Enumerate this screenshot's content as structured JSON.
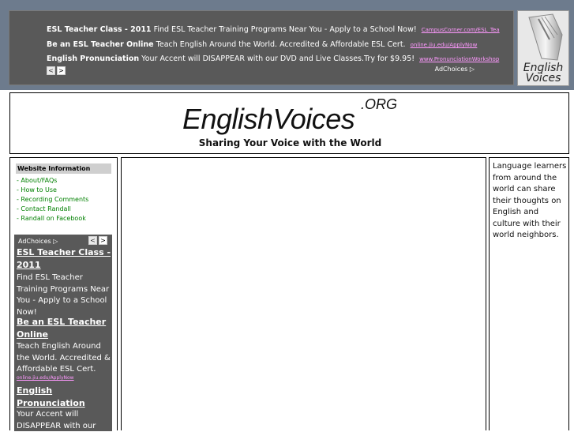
{
  "top_ad": {
    "lines": [
      {
        "title": "ESL Teacher Class - 2011",
        "body": "Find ESL Teacher Training Programs Near You - Apply to a School Now!",
        "url": "CampusCorner.com/ESL_Tea"
      },
      {
        "title": "Be an ESL Teacher Online",
        "body": "Teach English Around the World. Accredited & Affordable ESL Cert.",
        "url": "online.jiu.edu/ApplyNow"
      },
      {
        "title": "English Pronunciation",
        "body": "Your Accent will DISAPPEAR with our DVD and Live Classes.Try for $9.95!",
        "url": "www.PronunciationWorkshop"
      }
    ],
    "adchoices": "AdChoices ▷",
    "prev_icon": "<",
    "next_icon": ">"
  },
  "logo": {
    "text_line1": "English",
    "text_line2": "Voices"
  },
  "header": {
    "title": "EnglishVoices",
    "org": ".ORG",
    "tagline": "Sharing Your Voice with the World"
  },
  "sidebar": {
    "heading": "Website Information",
    "links": [
      "- About/FAQs",
      "- How to Use",
      "- Recording Comments",
      "- Contact Randall",
      "- Randall on Facebook"
    ]
  },
  "side_ad": {
    "adchoices": "AdChoices ▷",
    "prev_icon": "<",
    "next_icon": ">",
    "ad1_title_1": "ESL Teacher Class -",
    "ad1_title_2": "2011",
    "ad1_body": "Find ESL Teacher Training Programs Near You - Apply to a School Now!",
    "ad2_title_1": "Be an ESL Teacher",
    "ad2_title_2": "Online",
    "ad2_body": "Teach English Around the World. Accredited & Affordable ESL Cert.",
    "ad2_url": "online.jiu.edu/ApplyNow",
    "ad3_title_1": "English",
    "ad3_title_2": "Pronunciation",
    "ad3_body": "Your Accent will DISAPPEAR with our"
  },
  "right_panel": {
    "text": "Language learners from around the world can share their thoughts on English and culture with their world neighbors."
  },
  "colors": {
    "band": "#6d7b8d",
    "ad_bg": "#595959",
    "ad_link": "#ff99ff",
    "nav_link": "#008000"
  }
}
